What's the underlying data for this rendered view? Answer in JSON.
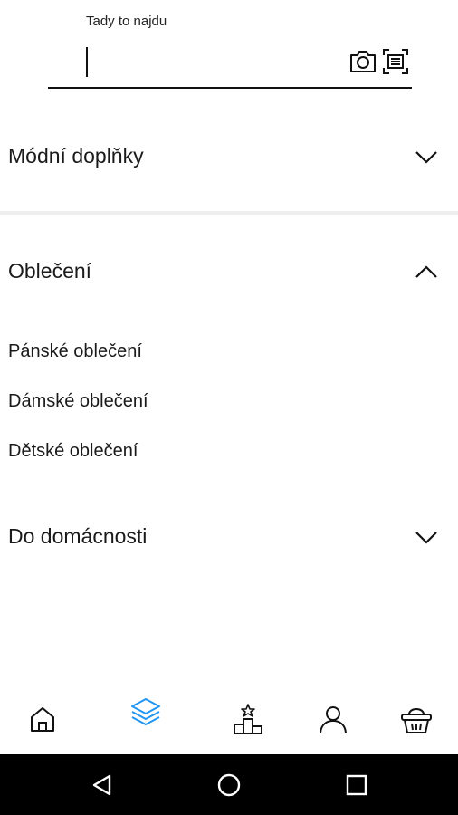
{
  "search": {
    "label": "Tady to najdu",
    "value": "",
    "icons": [
      "camera-icon",
      "barcode-scan-icon"
    ]
  },
  "categories": [
    {
      "title": "Módní doplňky",
      "expanded": false,
      "items": []
    },
    {
      "title": "Oblečení",
      "expanded": true,
      "items": [
        "Pánské oblečení",
        "Dámské oblečení",
        "Dětské oblečení"
      ]
    },
    {
      "title": "Do domácnosti",
      "expanded": false,
      "items": []
    }
  ],
  "bottom_nav": {
    "active": "categories",
    "accent_color": "#2196f3",
    "items": [
      "home-icon",
      "categories-layers-icon",
      "ranking-podium-icon",
      "profile-icon",
      "basket-icon"
    ]
  },
  "system_nav": [
    "back-icon",
    "home-circle-icon",
    "recents-icon"
  ]
}
